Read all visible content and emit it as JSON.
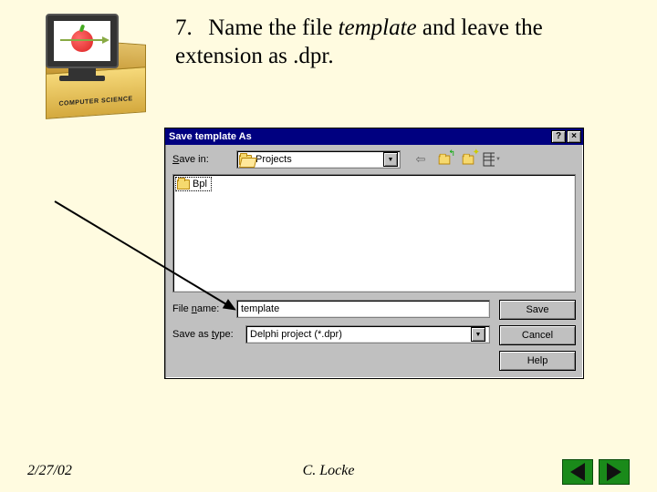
{
  "logo": {
    "caption": "COMPUTER SCIENCE"
  },
  "instruction": {
    "number": "7.",
    "text_before_italic": "Name the file ",
    "italic_word": "template",
    "text_after_italic": " and leave the extension as .dpr."
  },
  "dialog": {
    "title": "Save template As",
    "help_btn": "?",
    "close_btn": "×",
    "save_in_label": "Save in:",
    "save_in_value": "Projects",
    "toolbar": {
      "back": "⇦",
      "up": "📁↑",
      "new": "✳",
      "view": "☷"
    },
    "file_list": {
      "items": [
        {
          "name": "Bpl",
          "type": "folder"
        }
      ]
    },
    "filename_label": "File name:",
    "filename_value": "template",
    "savetype_label": "Save as type:",
    "savetype_value": "Delphi project (*.dpr)",
    "save_btn": "Save",
    "cancel_btn": "Cancel",
    "help_btn_label": "Help"
  },
  "footer": {
    "date": "2/27/02",
    "author": "C. Locke"
  }
}
